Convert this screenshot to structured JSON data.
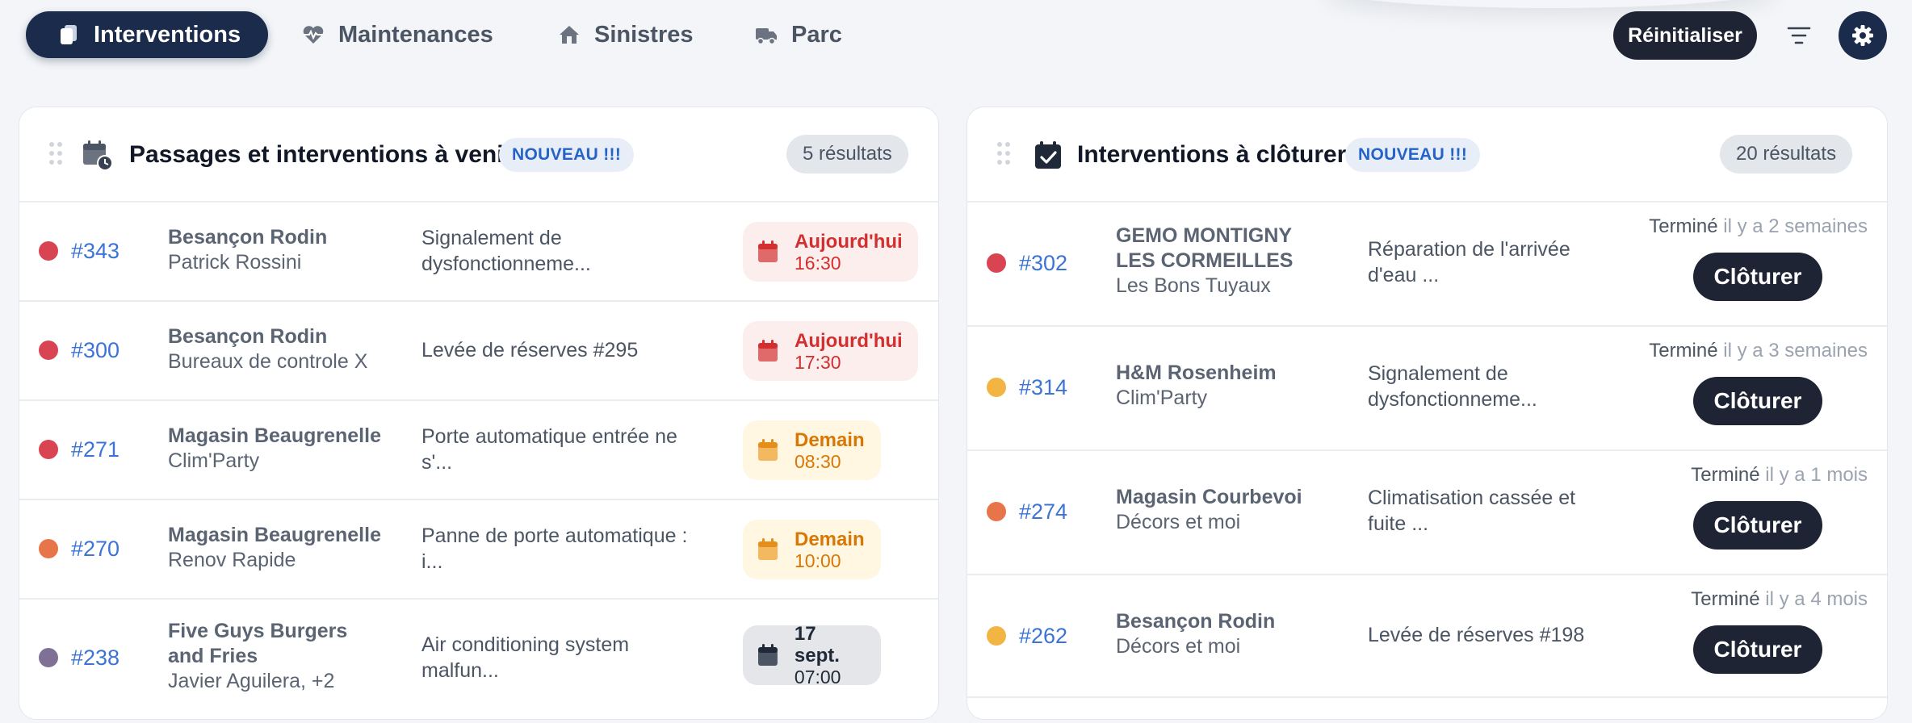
{
  "nav": {
    "tabs": [
      {
        "label": "Interventions",
        "icon": "document-icon"
      },
      {
        "label": "Maintenances",
        "icon": "heartbeat-icon"
      },
      {
        "label": "Sinistres",
        "icon": "house-icon"
      },
      {
        "label": "Parc",
        "icon": "truck-icon"
      }
    ],
    "reset_label": "Réinitialiser"
  },
  "colors": {
    "accent": "#1b2b4b",
    "link": "#3b74d6",
    "status_red": "#d94452",
    "status_orange": "#e8744a",
    "status_yellow": "#f2b544",
    "status_purple": "#7f7195"
  },
  "upcoming": {
    "title": "Passages et interventions à venir",
    "badge": "NOUVEAU !!!",
    "results": "5 résultats",
    "rows": [
      {
        "num": "#343",
        "status_color": "red",
        "site": "Besançon Rodin",
        "contractor": "Patrick Rossini",
        "desc": "Signalement de dysfonctionneme...",
        "date_label": "Aujourd'hui",
        "time": "16:30",
        "date_style": "red"
      },
      {
        "num": "#300",
        "status_color": "red",
        "site": "Besançon Rodin",
        "contractor": "Bureaux de controle X",
        "desc": "Levée de réserves #295",
        "date_label": "Aujourd'hui",
        "time": "17:30",
        "date_style": "red"
      },
      {
        "num": "#271",
        "status_color": "red",
        "site": "Magasin Beaugrenelle",
        "contractor": "Clim'Party",
        "desc": "Porte automatique entrée ne s'...",
        "date_label": "Demain",
        "time": "08:30",
        "date_style": "yellow"
      },
      {
        "num": "#270",
        "status_color": "orange",
        "site": "Magasin Beaugrenelle",
        "contractor": "Renov Rapide",
        "desc": "Panne de porte automatique : i...",
        "date_label": "Demain",
        "time": "10:00",
        "date_style": "yellow"
      },
      {
        "num": "#238",
        "status_color": "purple",
        "site": "Five Guys Burgers and Fries",
        "contractor": "Javier Aguilera, +2",
        "desc": "Air conditioning system malfun...",
        "date_label": "17 sept.",
        "time": "07:00",
        "date_style": "gray"
      }
    ]
  },
  "to_close": {
    "title": "Interventions à clôturer",
    "badge": "NOUVEAU !!!",
    "results": "20 résultats",
    "button_label": "Clôturer",
    "rows": [
      {
        "num": "#302",
        "status_color": "red",
        "site": "GEMO MONTIGNY LES CORMEILLES",
        "contractor": "Les Bons Tuyaux",
        "desc": "Réparation de l'arrivée d'eau ...",
        "status": "Terminé",
        "ago": "il y a 2 semaines"
      },
      {
        "num": "#314",
        "status_color": "yellow",
        "site": "H&M Rosenheim",
        "contractor": "Clim'Party",
        "desc": "Signalement de dysfonctionneme...",
        "status": "Terminé",
        "ago": "il y a 3 semaines"
      },
      {
        "num": "#274",
        "status_color": "orange",
        "site": "Magasin Courbevoi",
        "contractor": "Décors et moi",
        "desc": "Climatisation cassée et fuite ...",
        "status": "Terminé",
        "ago": "il y a 1 mois"
      },
      {
        "num": "#262",
        "status_color": "yellow",
        "site": "Besançon Rodin",
        "contractor": "Décors et moi",
        "desc": "Levée de réserves #198",
        "status": "Terminé",
        "ago": "il y a 4 mois"
      }
    ]
  }
}
